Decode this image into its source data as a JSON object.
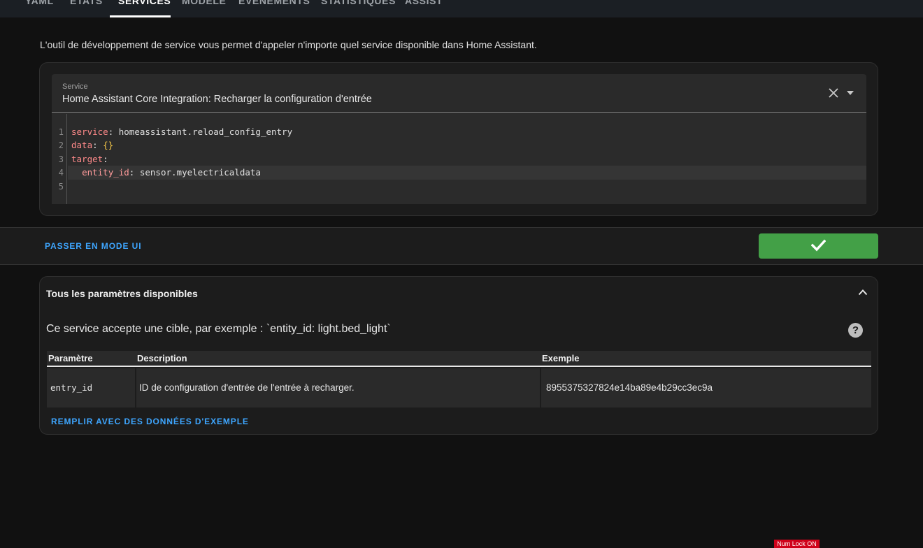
{
  "tabs": [
    {
      "label": "YAML"
    },
    {
      "label": "ÉTATS"
    },
    {
      "label": "SERVICES",
      "active": true
    },
    {
      "label": "MODÈLE"
    },
    {
      "label": "ÉVÉNEMENTS"
    },
    {
      "label": "STATISTIQUES"
    },
    {
      "label": "ASSIST"
    }
  ],
  "intro": "L'outil de développement de service vous permet d'appeler n'importe quel service disponible dans Home Assistant.",
  "service_field": {
    "label": "Service",
    "value": "Home Assistant Core Integration: Recharger la configuration d'entrée"
  },
  "editor": {
    "line_numbers": [
      "1",
      "2",
      "3",
      "4",
      "5"
    ],
    "lines": {
      "l1_key": "service",
      "l1_value": "homeassistant.reload_config_entry",
      "l2_key": "data",
      "l2_value": "{}",
      "l3_key": "target",
      "l4_key": "entity_id",
      "l4_value": "sensor.myelectricaldata"
    }
  },
  "actions": {
    "ui_mode_label": "PASSER EN MODE UI"
  },
  "params": {
    "title": "Tous les paramètres disponibles",
    "target_text": "Ce service accepte une cible, par exemple : `entity_id: light.bed_light`",
    "help_glyph": "?",
    "headers": [
      "Paramètre",
      "Description",
      "Exemple"
    ],
    "rows": [
      {
        "param": "entry_id",
        "description": "ID de configuration d'entrée de l'entrée à recharger.",
        "example": "8955375327824e14ba89e4b29cc3ec9a"
      }
    ],
    "fill_example_label": "REMPLIR AVEC DES DONNÉES D'EXEMPLE"
  },
  "status": {
    "numlock": "Num Lock ON"
  },
  "colors": {
    "accent": "#3ea6ff",
    "success": "#43a047",
    "background": "#111111",
    "card": "#1c1c1c"
  }
}
